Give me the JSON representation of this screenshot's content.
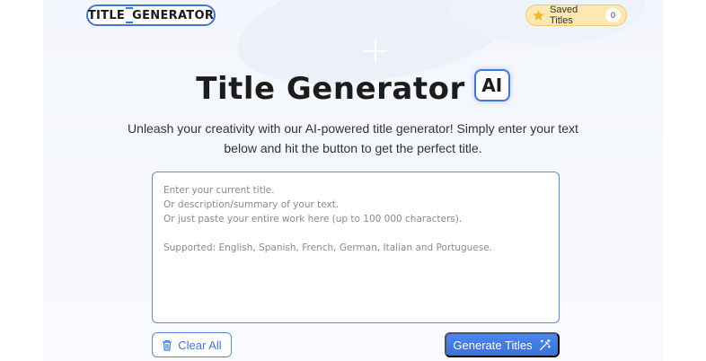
{
  "logo": {
    "left": "TITLE",
    "right": "GENERATOR"
  },
  "saved_titles": {
    "label": "Saved Titles",
    "count": "0"
  },
  "hero": {
    "title": "Title Generator",
    "badge": "AI"
  },
  "subtitle": "Unleash your creativity with our AI-powered title generator! Simply enter your text below and hit the button to get the perfect title.",
  "input": {
    "placeholder": "Enter your current title.\nOr description/summary of your text.\nOr just paste your entire work here (up to 100 000 characters).\n\nSupported: English, Spanish, French, German, Italian and Portuguese.",
    "value": ""
  },
  "buttons": {
    "clear": "Clear All",
    "generate": "Generate Titles"
  },
  "icons": {
    "saved": "star-icon",
    "clear": "trash-icon",
    "generate": "magic-wand-icon"
  },
  "colors": {
    "accent": "#3f78e0",
    "saved_bg": "#fde8b2",
    "star": "#f2b530"
  }
}
